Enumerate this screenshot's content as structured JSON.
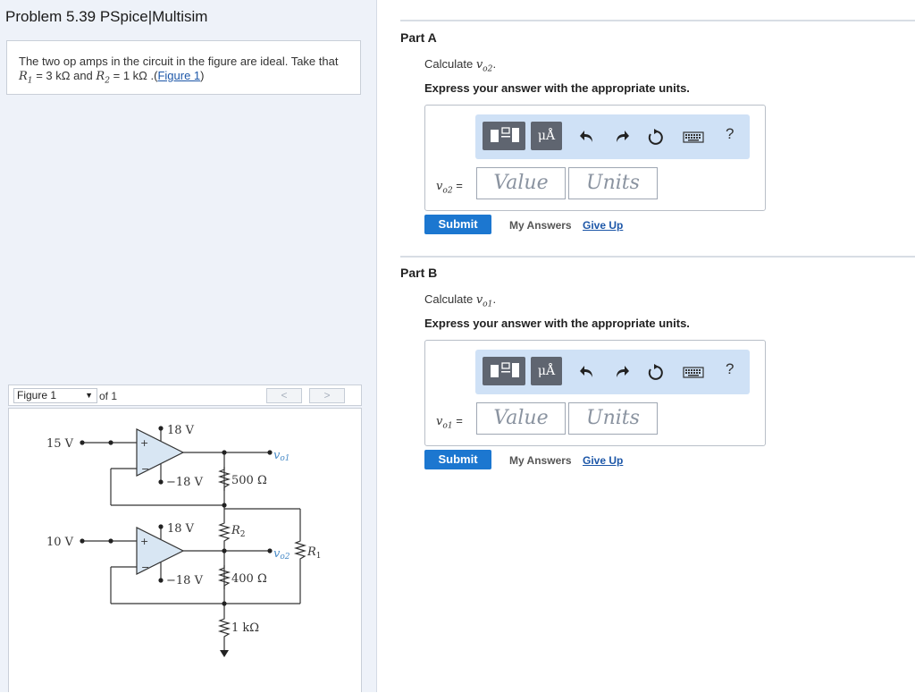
{
  "problem": {
    "title": "Problem 5.39 PSpice|Multisim",
    "text_pre": "The two op amps in the circuit in the figure are ideal. Take that ",
    "r1_sym": "R",
    "r1_sub": "1",
    "r1_val": " = 3 kΩ",
    "and": " and ",
    "r2_sym": "R",
    "r2_sub": "2",
    "r2_val": " = 1 kΩ",
    "link_pre": " .(",
    "link": "Figure 1",
    "link_post": ")"
  },
  "figure_nav": {
    "select": "Figure 1",
    "of": "of 1",
    "prev": "<",
    "next": ">"
  },
  "figure": {
    "v15": "15 V",
    "v10": "10 V",
    "p18a": "18 V",
    "n18a": "−18 V",
    "p18b": "18 V",
    "n18b": "−18 V",
    "r500": "500 Ω",
    "r400": "400 Ω",
    "r1k": "1 kΩ",
    "r2": "R",
    "r2sub": "2",
    "r1": "R",
    "r1sub": "1",
    "vo1": "v",
    "vo1sub": "o1",
    "vo2": "v",
    "vo2sub": "o2"
  },
  "parts": [
    {
      "label": "Part A",
      "calc_pre": "Calculate ",
      "var": "v",
      "var_sub": "o2",
      "calc_post": ".",
      "express": "Express your answer with the appropriate units.",
      "unit_btn": "μÅ",
      "help": "?",
      "input_label_sub": "o2",
      "eq": " =",
      "value_placeholder": "Value",
      "units_placeholder": "Units",
      "submit": "Submit",
      "my_answers": "My Answers",
      "give_up": "Give Up"
    },
    {
      "label": "Part B",
      "calc_pre": "Calculate ",
      "var": "v",
      "var_sub": "o1",
      "calc_post": ".",
      "express": "Express your answer with the appropriate units.",
      "unit_btn": "μÅ",
      "help": "?",
      "input_label_sub": "o1",
      "eq": " =",
      "value_placeholder": "Value",
      "units_placeholder": "Units",
      "submit": "Submit",
      "my_answers": "My Answers",
      "give_up": "Give Up"
    }
  ]
}
